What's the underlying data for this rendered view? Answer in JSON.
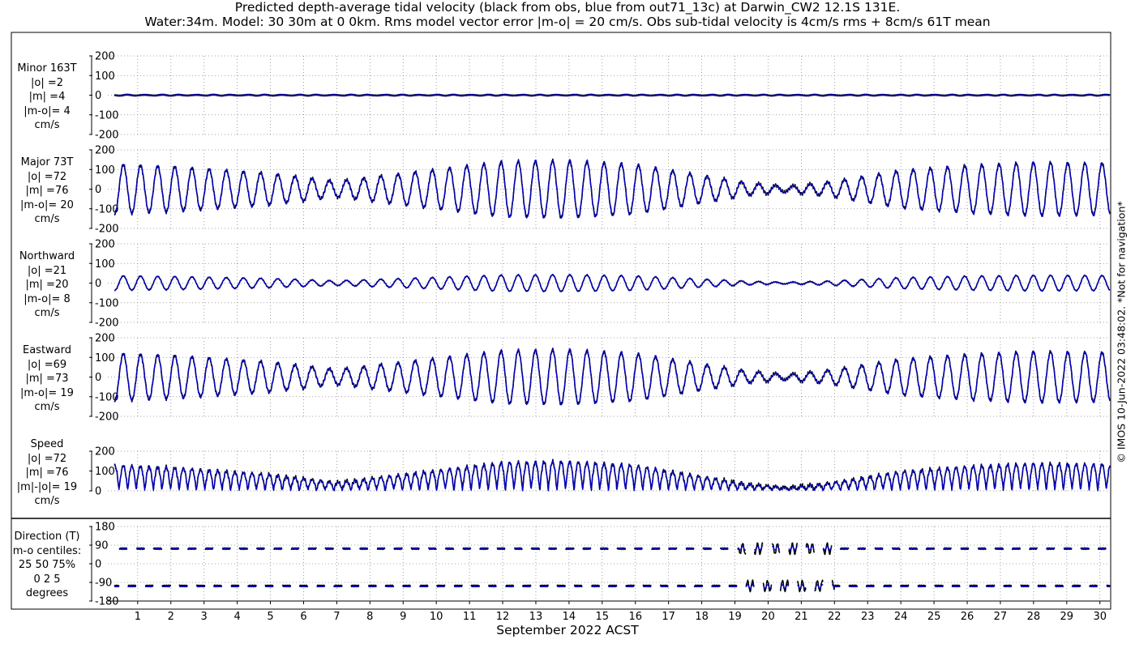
{
  "title": {
    "line1": "Predicted depth-average tidal velocity (black from obs, blue from out71_13c) at Darwin_CW2 12.1S 131E.",
    "line2": "Water:34m. Model: 30 30m at 0 0km. Rms model vector error |m-o| = 20 cm/s. Obs sub-tidal velocity is 4cm/s rms + 8cm/s 61T mean"
  },
  "xlabel": "September 2022 ACST",
  "side_note": "© IMOS 10-Jun-2022 03:48:02. *Not for navigation*",
  "colors": {
    "obs": "#000000",
    "model": "#0000cc",
    "grid": "#888888",
    "axes": "#000000"
  },
  "chart_data": {
    "type": "line",
    "x_unit": "day of September 2022 (ACST)",
    "xlim": [
      0.1,
      30.3
    ],
    "xticks": [
      1,
      2,
      3,
      4,
      5,
      6,
      7,
      8,
      9,
      10,
      11,
      12,
      13,
      14,
      15,
      16,
      17,
      18,
      19,
      20,
      21,
      22,
      23,
      24,
      25,
      26,
      27,
      28,
      29,
      30
    ],
    "series_legend": {
      "obs": "black from obs",
      "model": "blue from out71_13c"
    },
    "spring_neap_envelope_cm_s": {
      "x": [
        0.3,
        2.0,
        5.0,
        7.0,
        10.0,
        12.0,
        14.0,
        16.0,
        18.0,
        19.5,
        20.6,
        22.0,
        24.0,
        26.0,
        28.0,
        30.3
      ],
      "amplitude": [
        125,
        115,
        80,
        40,
        100,
        140,
        145,
        125,
        70,
        30,
        15,
        40,
        95,
        120,
        135,
        130
      ]
    },
    "panels": [
      {
        "id": "minor",
        "labels": [
          "Minor 163T",
          "|o| =2",
          "|m| =4",
          "|m-o|= 4",
          "cm/s"
        ],
        "ylim": [
          -200,
          200
        ],
        "yticks": [
          200,
          100,
          0,
          -100,
          -200
        ],
        "component": "minor"
      },
      {
        "id": "major",
        "labels": [
          "Major 73T",
          "|o| =72",
          "|m| =76",
          "|m-o|= 20",
          "cm/s"
        ],
        "ylim": [
          -200,
          200
        ],
        "yticks": [
          200,
          100,
          0,
          -100,
          -200
        ],
        "component": "major"
      },
      {
        "id": "northward",
        "labels": [
          "Northward",
          "|o| =21",
          "|m| =20",
          "|m-o|= 8",
          "cm/s"
        ],
        "ylim": [
          -200,
          200
        ],
        "yticks": [
          200,
          100,
          0,
          -100,
          -200
        ],
        "component": "north"
      },
      {
        "id": "eastward",
        "labels": [
          "Eastward",
          "|o| =69",
          "|m| =73",
          "|m-o|= 19",
          "cm/s"
        ],
        "ylim": [
          -200,
          200
        ],
        "yticks": [
          200,
          100,
          0,
          -100,
          -200
        ],
        "component": "east"
      },
      {
        "id": "speed",
        "labels": [
          "Speed",
          "|o| =72",
          "|m| =76",
          "|m|-|o|= 19",
          "cm/s"
        ],
        "ylim": [
          0,
          200
        ],
        "yticks": [
          200,
          100,
          0
        ],
        "component": "speed"
      },
      {
        "id": "direction",
        "labels": [
          "Direction (T)",
          "m-o centiles:",
          "25  50  75%",
          "0  2  5",
          "degrees"
        ],
        "ylim": [
          -180,
          180
        ],
        "yticks": [
          180,
          90,
          0,
          -90,
          -180
        ],
        "component": "direction"
      }
    ]
  }
}
